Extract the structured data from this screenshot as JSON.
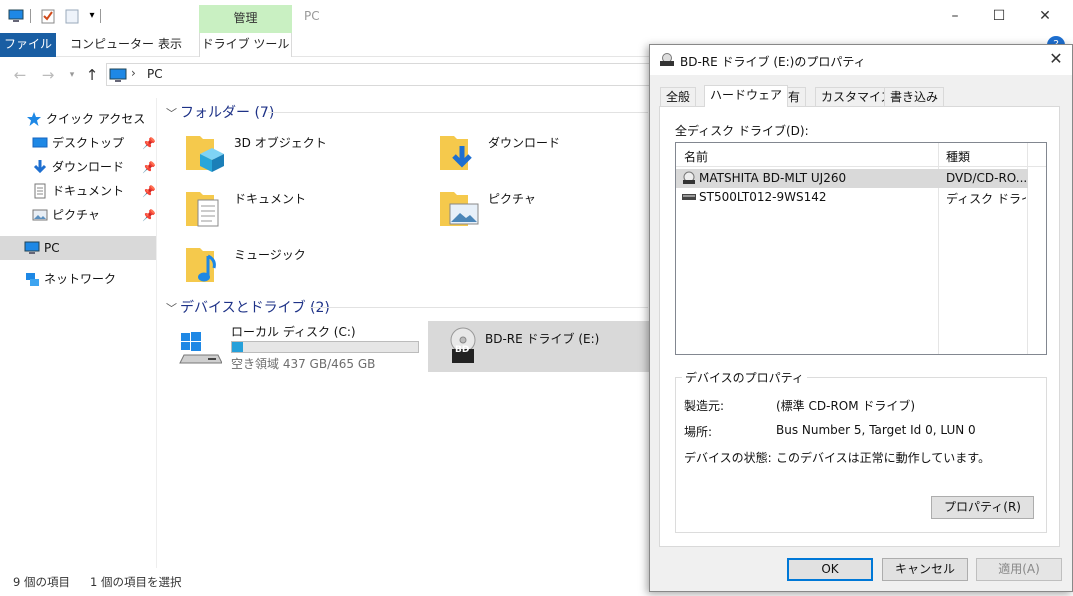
{
  "explorer": {
    "ribbon_context_group": "管理",
    "window_title": "PC",
    "ribbon_tabs": {
      "file": "ファイル",
      "computer": "コンピューター",
      "view": "表示",
      "drive_tools": "ドライブ ツール"
    },
    "address": "PC",
    "nav": {
      "quick_access": "クイック アクセス",
      "items": [
        "デスクトップ",
        "ダウンロード",
        "ドキュメント",
        "ピクチャ"
      ],
      "pc": "PC",
      "network": "ネットワーク"
    },
    "folders_group": "フォルダー (7)",
    "folders": [
      "3D オブジェクト",
      "ダウンロード",
      "ドキュメント",
      "ピクチャ",
      "ミュージック"
    ],
    "devices_group": "デバイスとドライブ (2)",
    "drives": {
      "local": {
        "name": "ローカル ディスク (C:)",
        "free": "空き領域 437 GB/465 GB",
        "used_fraction": 0.06
      },
      "bd": {
        "name": "BD-RE ドライブ (E:)",
        "badge": "BD"
      }
    },
    "status": {
      "count": "9 個の項目",
      "selected": "1 個の項目を選択"
    }
  },
  "dialog": {
    "title": "BD-RE ドライブ (E:)のプロパティ",
    "tabs": [
      "全般",
      "ハードウェア",
      "共有",
      "カスタマイズ",
      "書き込み"
    ],
    "all_drives_label": "全ディスク ドライブ(D):",
    "columns": {
      "name": "名前",
      "type": "種類"
    },
    "rows": [
      {
        "name": "MATSHITA BD-MLT UJ260",
        "type": "DVD/CD-RO..."
      },
      {
        "name": "ST500LT012-9WS142",
        "type": "ディスク ドライブ"
      }
    ],
    "device_props_label": "デバイスのプロパティ",
    "manufacturer_label": "製造元:",
    "manufacturer_value": "(標準 CD-ROM ドライブ)",
    "location_label": "場所:",
    "location_value": "Bus Number 5, Target Id 0, LUN 0",
    "status_label": "デバイスの状態:",
    "status_value": "このデバイスは正常に動作しています。",
    "properties_button": "プロパティ(R)",
    "ok": "OK",
    "cancel": "キャンセル",
    "apply": "適用(A)"
  },
  "colors": {
    "accent": "#0078d7",
    "file_tab": "#195ea3",
    "context_tab": "#c9f0c2",
    "folder_title": "#1e3287"
  }
}
